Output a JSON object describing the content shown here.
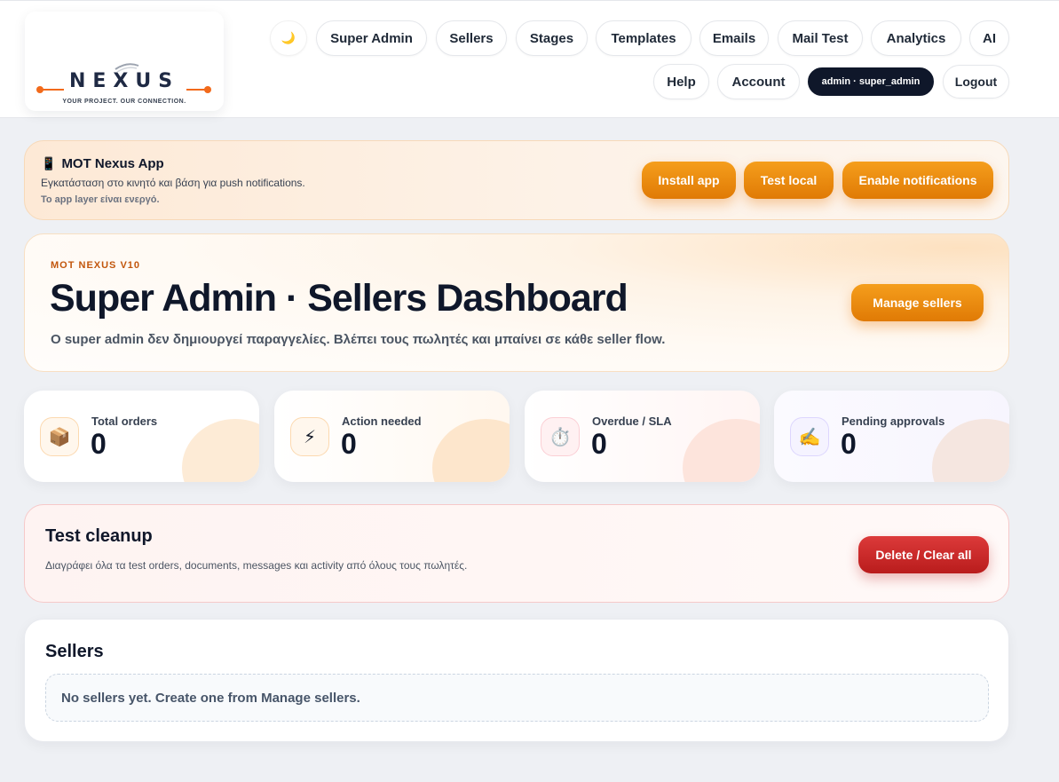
{
  "logo": {
    "wordmark": "NEXUS",
    "tagline": "YOUR PROJECT. OUR CONNECTION."
  },
  "nav": {
    "theme_icon": "🌙",
    "row1": [
      "Super Admin",
      "Sellers",
      "Stages",
      "Templates",
      "Emails",
      "Mail Test",
      "Analytics",
      "AI"
    ],
    "help": "Help",
    "account": "Account",
    "user_badge": "admin · super_admin",
    "logout": "Logout"
  },
  "app_banner": {
    "icon": "📱",
    "title": "MOT Nexus App",
    "subtitle": "Εγκατάσταση στο κινητό και βάση για push notifications.",
    "status": "Το app layer είναι ενεργό.",
    "install": "Install app",
    "test_local": "Test local",
    "enable_notifications": "Enable notifications"
  },
  "hero": {
    "eyebrow": "MOT NEXUS V10",
    "title": "Super Admin · Sellers Dashboard",
    "subtitle": "Ο super admin δεν δημιουργεί παραγγελίες. Βλέπει τους πωλητές και μπαίνει σε κάθε seller flow.",
    "manage_sellers": "Manage sellers"
  },
  "stats": [
    {
      "label": "Total orders",
      "value": "0",
      "icon": "📦"
    },
    {
      "label": "Action needed",
      "value": "0",
      "icon": "⚡"
    },
    {
      "label": "Overdue / SLA",
      "value": "0",
      "icon": "⏱️"
    },
    {
      "label": "Pending approvals",
      "value": "0",
      "icon": "✍️"
    }
  ],
  "cleanup": {
    "title": "Test cleanup",
    "description": "Διαγράφει όλα τα test orders, documents, messages και activity από όλους τους πωλητές.",
    "button": "Delete / Clear all"
  },
  "sellers": {
    "title": "Sellers",
    "empty": "No sellers yet. Create one from Manage sellers."
  },
  "colors": {
    "accent_orange": "#e98a0c",
    "danger_red": "#c62828",
    "dark": "#0f172a"
  }
}
